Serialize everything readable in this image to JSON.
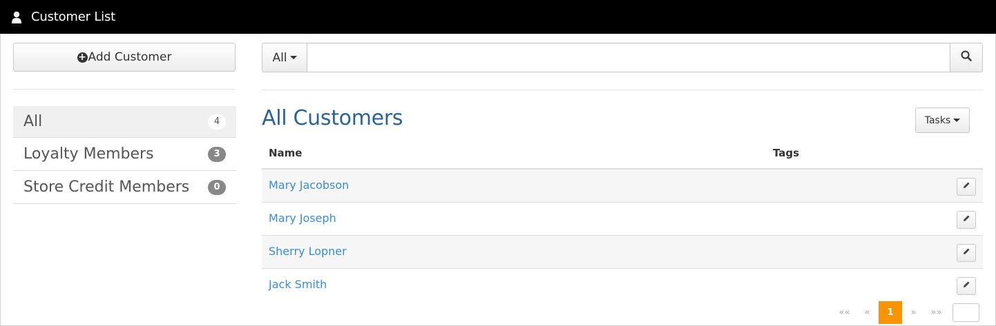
{
  "header": {
    "title": "Customer List",
    "icon": "user-icon"
  },
  "sidebar": {
    "add_button_label": "Add Customer",
    "filters": [
      {
        "label": "All",
        "count": "4",
        "active": true
      },
      {
        "label": "Loyalty Members",
        "count": "3",
        "active": false
      },
      {
        "label": "Store Credit Members",
        "count": "0",
        "active": false
      }
    ]
  },
  "search": {
    "scope_label": "All",
    "value": "",
    "placeholder": ""
  },
  "main": {
    "section_title": "All Customers",
    "tasks_label": "Tasks",
    "columns": [
      "Name",
      "Tags"
    ],
    "rows": [
      {
        "name": "Mary Jacobson",
        "tags": ""
      },
      {
        "name": "Mary Joseph",
        "tags": ""
      },
      {
        "name": "Sherry Lopner",
        "tags": ""
      },
      {
        "name": "Jack Smith",
        "tags": ""
      }
    ]
  },
  "pagination": {
    "first": "««",
    "prev": "«",
    "current": "1",
    "next": "»",
    "last": "»»",
    "page_input": ""
  },
  "colors": {
    "accent_link": "#3a8ccf",
    "title": "#2a6496",
    "current_page": "#f89406",
    "topbar": "#000000"
  }
}
